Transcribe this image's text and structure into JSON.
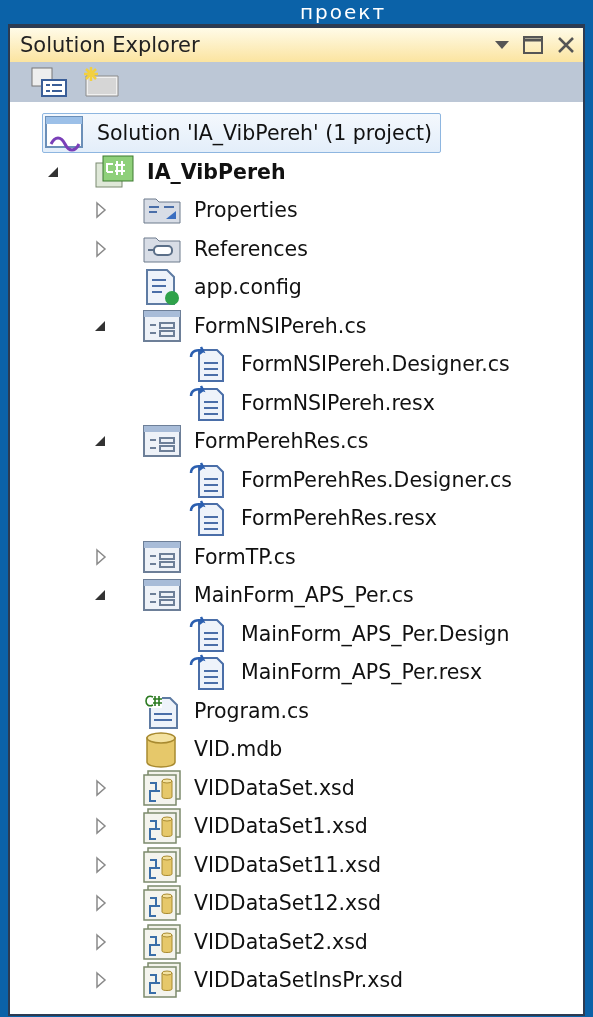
{
  "slide": {
    "heading": "проект"
  },
  "window": {
    "title": "Solution Explorer"
  },
  "tree": [
    {
      "label": "Solution 'IA_VibPereh' (1 project)",
      "kind": "solution",
      "selected": true,
      "children": [
        {
          "label": "IA_VibPereh",
          "kind": "csproj",
          "expanded": true,
          "selected": false,
          "children": [
            {
              "label": "Properties",
              "kind": "properties",
              "expanded": false,
              "selected": false
            },
            {
              "label": "References",
              "kind": "references",
              "expanded": false,
              "selected": false
            },
            {
              "label": "app.config",
              "kind": "config",
              "selected": false
            },
            {
              "label": "FormNSIPereh.cs",
              "kind": "form",
              "expanded": true,
              "selected": false,
              "children": [
                {
                  "label": "FormNSIPereh.Designer.cs",
                  "kind": "resource",
                  "selected": false
                },
                {
                  "label": "FormNSIPereh.resx",
                  "kind": "resource",
                  "selected": false
                }
              ]
            },
            {
              "label": "FormPerehRes.cs",
              "kind": "form",
              "expanded": true,
              "selected": false,
              "children": [
                {
                  "label": "FormPerehRes.Designer.cs",
                  "kind": "resource",
                  "selected": false
                },
                {
                  "label": "FormPerehRes.resx",
                  "kind": "resource",
                  "selected": false
                }
              ]
            },
            {
              "label": "FormTP.cs",
              "kind": "form",
              "expanded": false,
              "selected": false
            },
            {
              "label": "MainForm_APS_Per.cs",
              "kind": "form",
              "expanded": true,
              "selected": false,
              "children": [
                {
                  "label": "MainForm_APS_Per.Design",
                  "kind": "resource",
                  "selected": false
                },
                {
                  "label": "MainForm_APS_Per.resx",
                  "kind": "resource",
                  "selected": false
                }
              ]
            },
            {
              "label": "Program.cs",
              "kind": "csharp",
              "selected": false
            },
            {
              "label": "VID.mdb",
              "kind": "database",
              "selected": false
            },
            {
              "label": "VIDDataSet.xsd",
              "kind": "dataset",
              "expanded": false,
              "selected": false
            },
            {
              "label": "VIDDataSet1.xsd",
              "kind": "dataset",
              "expanded": false,
              "selected": false
            },
            {
              "label": "VIDDataSet11.xsd",
              "kind": "dataset",
              "expanded": false,
              "selected": false
            },
            {
              "label": "VIDDataSet12.xsd",
              "kind": "dataset",
              "expanded": false,
              "selected": false
            },
            {
              "label": "VIDDataSet2.xsd",
              "kind": "dataset",
              "expanded": false,
              "selected": false
            },
            {
              "label": "VIDDataSetInsPr.xsd",
              "kind": "dataset",
              "expanded": false,
              "selected": false
            }
          ]
        }
      ]
    }
  ]
}
